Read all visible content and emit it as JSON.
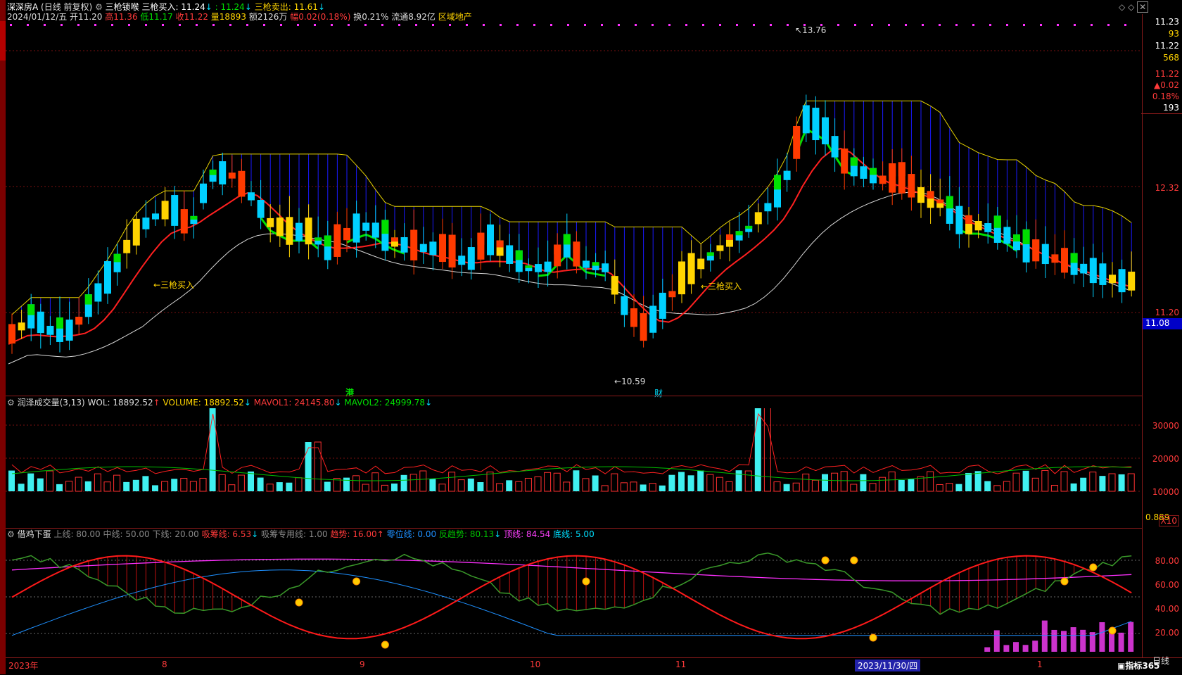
{
  "stock": {
    "name": "深深房A",
    "mode": "(日线 前复权)",
    "indicator_name": "三枪锁喉",
    "buy_label": "三枪买入: 11.24",
    "buy_value": ": 11.24",
    "sell_label": "三枪卖出: 11.61",
    "date": "2024/01/12/五",
    "open": "开11.20",
    "high": "高11.36",
    "low": "低11.17",
    "close": "收11.22",
    "volume": "量18893",
    "amount": "额2126万",
    "change": "幅0.02(0.18%)",
    "turnover": "换0.21%",
    "float": "流通8.92亿",
    "sector": "区域地产"
  },
  "main_chart": {
    "price_high_label": "13.76",
    "price_low_label": "10.59",
    "buy_annotation_1": "←三枪买入",
    "buy_annotation_2": "←三枪买入",
    "hk_marker": "港",
    "fin_marker": "财",
    "axis_labels": [
      "11.23",
      "93",
      "11.22",
      "568",
      "11.22",
      "▲0.02",
      "0.18%",
      "193",
      "12.32",
      "11.20"
    ],
    "current_price_tag": "11.08",
    "colors": {
      "up": "#ff3a00",
      "down": "#00d0ff",
      "yellow": "#ffd400",
      "green": "#00e000",
      "ma_red": "#ff2020",
      "ma_white": "#d8d8d8",
      "cloud_blue": "#1a1aff",
      "cloud_yellow": "#e6d200"
    }
  },
  "volume_panel": {
    "title": "润泽成交量(3,13)",
    "wol": "WOL: 18892.52",
    "volume": "VOLUME: 18892.52",
    "mavol1": "MAVOL1: 24145.80",
    "mavol2": "MAVOL2: 24999.78",
    "axis_labels": [
      "30000",
      "20000",
      "10000"
    ],
    "last_value": "0.889",
    "unit": "X10"
  },
  "egg_panel": {
    "title": "借鸡下蛋",
    "upper": "上线: 80.00",
    "middle": "中线: 50.00",
    "lower": "下线: 20.00",
    "xichou": "吸筹线: 6.53",
    "xichou_special": "吸筹专用线: 1.00",
    "trend": "趋势: 16.00",
    "shift": "零位线: 0.00",
    "reverse": "反趋势: 80.13",
    "top": "顶线: 84.54",
    "bottom": "底线: 5.00",
    "axis_labels": [
      "80.00",
      "60.00",
      "40.00",
      "20.00"
    ]
  },
  "time_axis": {
    "labels": [
      "2023年",
      "8",
      "9",
      "10",
      "11",
      "1"
    ],
    "highlighted": "2023/11/30/四",
    "period": "日线",
    "brand": "指标365"
  }
}
